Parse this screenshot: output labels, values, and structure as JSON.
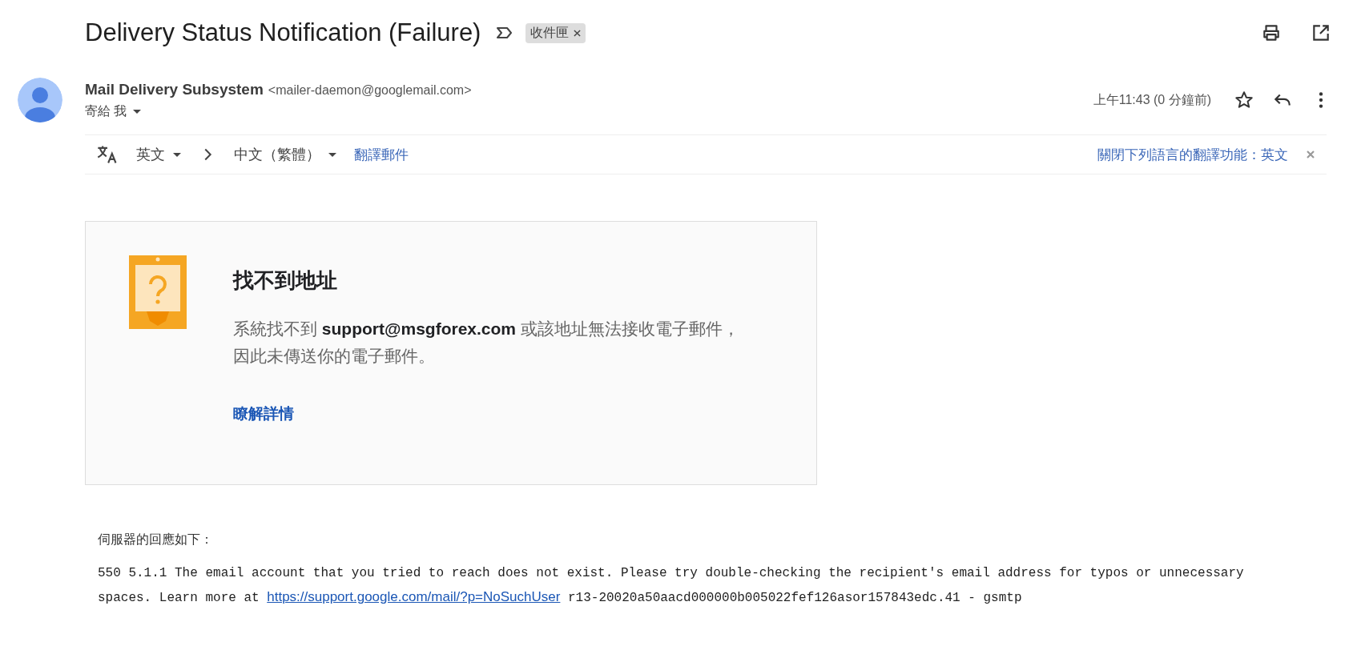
{
  "subject": {
    "title": "Delivery Status Notification (Failure)",
    "label": "收件匣"
  },
  "sender": {
    "name": "Mail Delivery Subsystem",
    "address": "<mailer-daemon@googlemail.com>",
    "to": "寄給 我",
    "time": "上午11:43 (0 分鐘前)",
    "starred": false
  },
  "translate": {
    "from": "英文",
    "to": "中文（繁體）",
    "action": "翻譯郵件",
    "turn_off": "關閉下列語言的翻譯功能：英文"
  },
  "card": {
    "title": "找不到地址",
    "message": "系統找不到 **support@msgforex.com** 或該地址無法接收電子郵件，因此未傳送你的電子郵件。",
    "link": "瞭解詳情"
  },
  "server": {
    "heading": "伺服器的回應如下：",
    "before": "550 5.1.1 The email account that you tried to reach does not exist. Please try double-checking the recipient's email address for typos or unnecessary spaces. Learn more at ",
    "link": "https://support.google.com/mail/?p=NoSuchUser",
    "after": " r13-20020a50aacd000000b005022fef126asor157843edc.41 - gsmtp"
  }
}
